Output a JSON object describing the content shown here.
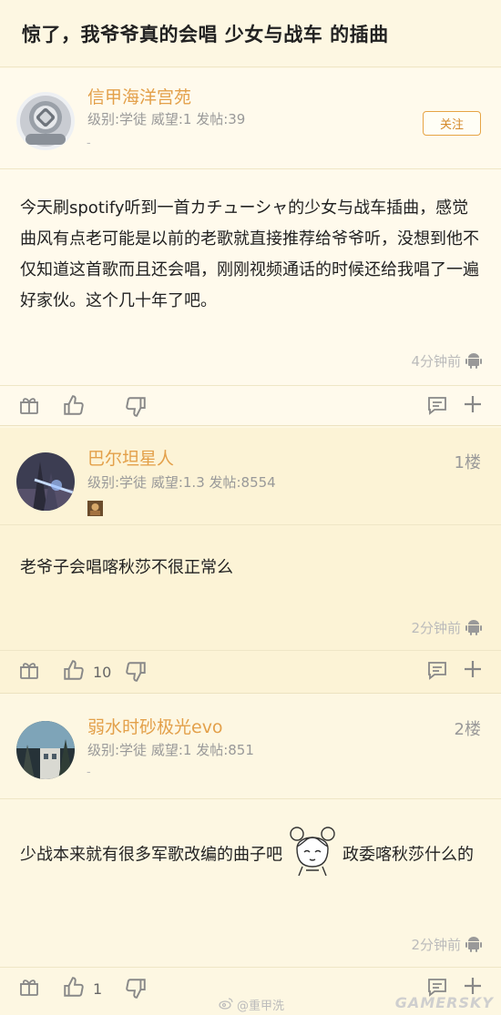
{
  "title": "惊了，我爷爷真的会唱 少女与战车 的插曲",
  "op": {
    "username": "信甲海洋宫苑",
    "meta": "级别:学徒 威望:1 发帖:39",
    "dash": "-",
    "follow_label": "关注",
    "content": "今天刷spotify听到一首カチューシャ的少女与战车插曲，感觉曲风有点老可能是以前的老歌就直接推荐给爷爷听，没想到他不仅知道这首歌而且还会唱，刚刚视频通话的时候还给我唱了一遍 好家伙。这个几十年了吧。",
    "time": "4分钟前"
  },
  "replies": [
    {
      "username": "巴尔坦星人",
      "meta": "级别:学徒 威望:1.3 发帖:8554",
      "floor": "1楼",
      "content": "老爷子会唱喀秋莎不很正常么",
      "time": "2分钟前",
      "like_count": "10"
    },
    {
      "username": "弱水时砂极光evo",
      "meta": "级别:学徒 威望:1 发帖:851",
      "dash": "-",
      "floor": "2楼",
      "content_before": "少战本来就有很多军歌改编的曲子吧",
      "content_after": "政委喀秋莎什么的",
      "time": "2分钟前",
      "like_count": "1"
    }
  ],
  "watermark": "@重甲洗",
  "brand": "GAMERSKY",
  "colors": {
    "accent": "#e3a04a",
    "background": "#fdf7e2",
    "icon": "#888888"
  },
  "icons": [
    "gift-icon",
    "thumbs-up-icon",
    "thumbs-down-icon",
    "comment-icon",
    "plus-icon",
    "android-icon"
  ]
}
